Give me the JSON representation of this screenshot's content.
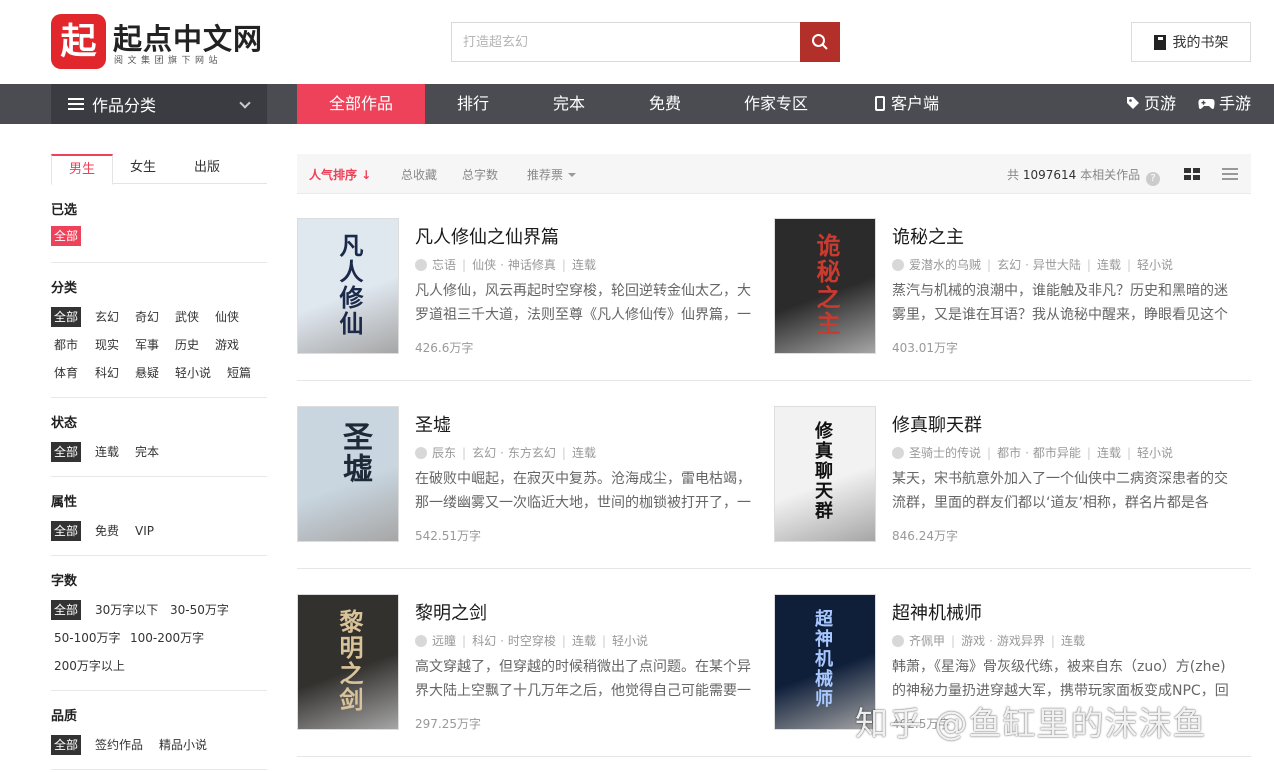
{
  "header": {
    "logo_mark": "起",
    "logo_title": "起点中文网",
    "logo_subtitle": "阅文集团旗下网站",
    "search_placeholder": "打造超玄幻",
    "bookshelf_label": "我的书架"
  },
  "nav": {
    "category_menu": "作品分类",
    "items": [
      "全部作品",
      "排行",
      "完本",
      "免费",
      "作家专区",
      "客户端"
    ],
    "right_items": [
      "页游",
      "手游"
    ]
  },
  "sidebar": {
    "gender_tabs": [
      "男生",
      "女生",
      "出版"
    ],
    "selected_title": "已选",
    "selected_tag": "全部",
    "category_title": "分类",
    "category_tags": [
      "全部",
      "玄幻",
      "奇幻",
      "武侠",
      "仙侠",
      "都市",
      "现实",
      "军事",
      "历史",
      "游戏",
      "体育",
      "科幻",
      "悬疑",
      "轻小说",
      "短篇"
    ],
    "status_title": "状态",
    "status_tags": [
      "全部",
      "连载",
      "完本"
    ],
    "attr_title": "属性",
    "attr_tags": [
      "全部",
      "免费",
      "VIP"
    ],
    "words_title": "字数",
    "words_tags": [
      "全部",
      "30万字以下",
      "30-50万字",
      "50-100万字",
      "100-200万字",
      "200万字以上"
    ],
    "quality_title": "品质",
    "quality_tags": [
      "全部",
      "签约作品",
      "精品小说"
    ]
  },
  "sortbar": {
    "items": [
      "人气排序 ↓",
      "总收藏",
      "总字数",
      "推荐票"
    ],
    "total_prefix": "共",
    "total_count": "1097614",
    "total_suffix": "本相关作品",
    "help": "?"
  },
  "books": [
    {
      "title": "凡人修仙之仙界篇",
      "author": "忘语",
      "cat": "仙侠",
      "sub": "神话修真",
      "status": "连载",
      "extra": "",
      "intro": "凡人修仙，风云再起时空穿梭，轮回逆转金仙太乙，大罗道祖三千大道，法则至尊《凡人修仙传》仙界篇，一",
      "words": "426.6万字",
      "cover_text": "凡人修仙",
      "cover_bg": "#dfe7ef",
      "cover_color": "#1b2a4a"
    },
    {
      "title": "诡秘之主",
      "author": "爱潜水的乌贼",
      "cat": "玄幻",
      "sub": "异世大陆",
      "status": "连载",
      "extra": "轻小说",
      "intro": "蒸汽与机械的浪潮中，谁能触及非凡？历史和黑暗的迷雾里，又是谁在耳语？我从诡秘中醒来，睁眼看见这个",
      "words": "403.01万字",
      "cover_text": "诡秘之主",
      "cover_bg": "#2b2b2b",
      "cover_color": "#c93a2f"
    },
    {
      "title": "圣墟",
      "author": "辰东",
      "cat": "玄幻",
      "sub": "东方玄幻",
      "status": "连载",
      "extra": "",
      "intro": "在破败中崛起，在寂灭中复苏。沧海成尘，雷电枯竭，那一缕幽雾又一次临近大地，世间的枷锁被打开了，一",
      "words": "542.51万字",
      "cover_text": "圣墟",
      "cover_bg": "#c9d6e0",
      "cover_color": "#1d2a38"
    },
    {
      "title": "修真聊天群",
      "author": "圣骑士的传说",
      "cat": "都市",
      "sub": "都市异能",
      "status": "连载",
      "extra": "轻小说",
      "intro": "某天，宋书航意外加入了一个仙侠中二病资深患者的交流群，里面的群友们都以‘道友’相称，群名片都是各",
      "words": "846.24万字",
      "cover_text": "修真聊天群",
      "cover_bg": "#f2f2f2",
      "cover_color": "#111"
    },
    {
      "title": "黎明之剑",
      "author": "远瞳",
      "cat": "科幻",
      "sub": "时空穿梭",
      "status": "连载",
      "extra": "轻小说",
      "intro": "高文穿越了，但穿越的时候稍微出了点问题。在某个异界大陆上空飘了十几万年之后，他觉得自己可能需要一",
      "words": "297.25万字",
      "cover_text": "黎明之剑",
      "cover_bg": "#33312e",
      "cover_color": "#d9c39a"
    },
    {
      "title": "超神机械师",
      "author": "齐佩甲",
      "cat": "游戏",
      "sub": "游戏异界",
      "status": "连载",
      "extra": "",
      "intro": "韩萧，《星海》骨灰级代练，被来自东（zuo）方(zhe)的神秘力量扔进穿越大军，携带玩家面板变成NPC，回到",
      "words": "402.5万字",
      "cover_text": "超神机械师",
      "cover_bg": "#0f1f3a",
      "cover_color": "#a8c8ff"
    }
  ],
  "watermark": "知乎 @鱼缸里的沫沫鱼",
  "colors": {
    "accent": "#ed4259",
    "brand": "#e1262c",
    "search_btn": "#b3302a",
    "navbar": "#4b4c52"
  }
}
